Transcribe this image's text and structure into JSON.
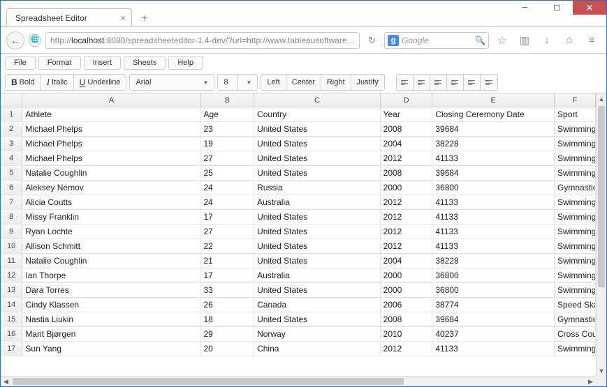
{
  "window": {
    "tab_title": "Spreadsheet Editor",
    "url_prefix": "http://",
    "url_host": "localhost",
    "url_rest": ":8080/spreadsheeteditor-1.4-dev/?url=http://www.tableausoftware…",
    "search_placeholder": "Google"
  },
  "menu": {
    "file": "File",
    "format": "Format",
    "insert": "Insert",
    "sheets": "Sheets",
    "help": "Help"
  },
  "toolbar": {
    "bold": "Bold",
    "italic": "Italic",
    "underline": "Underline",
    "font": "Arial",
    "size": "8",
    "left": "Left",
    "center": "Center",
    "right": "Right",
    "justify": "Justify"
  },
  "sheet": {
    "columns": [
      "A",
      "B",
      "C",
      "D",
      "E",
      "F"
    ],
    "col_widths_class": [
      "cA",
      "cB",
      "cC",
      "cD",
      "cE",
      "cF"
    ],
    "rows": [
      {
        "n": 1,
        "cells": [
          "Athlete",
          "Age",
          "Country",
          "Year",
          "Closing Ceremony Date",
          "Sport"
        ]
      },
      {
        "n": 2,
        "cells": [
          "Michael Phelps",
          "23",
          "United States",
          "2008",
          "39684",
          "Swimming"
        ]
      },
      {
        "n": 3,
        "cells": [
          "Michael Phelps",
          "19",
          "United States",
          "2004",
          "38228",
          "Swimming"
        ]
      },
      {
        "n": 4,
        "cells": [
          "Michael Phelps",
          "27",
          "United States",
          "2012",
          "41133",
          "Swimming"
        ]
      },
      {
        "n": 5,
        "cells": [
          "Natalie Coughlin",
          "25",
          "United States",
          "2008",
          "39684",
          "Swimming"
        ]
      },
      {
        "n": 6,
        "cells": [
          "Aleksey Nemov",
          "24",
          "Russia",
          "2000",
          "36800",
          "Gymnastics"
        ]
      },
      {
        "n": 7,
        "cells": [
          "Alicia Coutts",
          "24",
          "Australia",
          "2012",
          "41133",
          "Swimming"
        ]
      },
      {
        "n": 8,
        "cells": [
          "Missy Franklin",
          "17",
          "United States",
          "2012",
          "41133",
          "Swimming"
        ]
      },
      {
        "n": 9,
        "cells": [
          "Ryan Lochte",
          "27",
          "United States",
          "2012",
          "41133",
          "Swimming"
        ]
      },
      {
        "n": 10,
        "cells": [
          "Allison Schmitt",
          "22",
          "United States",
          "2012",
          "41133",
          "Swimming"
        ]
      },
      {
        "n": 11,
        "cells": [
          "Natalie Coughlin",
          "21",
          "United States",
          "2004",
          "38228",
          "Swimming"
        ]
      },
      {
        "n": 12,
        "cells": [
          "Ian Thorpe",
          "17",
          "Australia",
          "2000",
          "36800",
          "Swimming"
        ]
      },
      {
        "n": 13,
        "cells": [
          "Dara Torres",
          "33",
          "United States",
          "2000",
          "36800",
          "Swimming"
        ]
      },
      {
        "n": 14,
        "cells": [
          "Cindy Klassen",
          "26",
          "Canada",
          "2006",
          "38774",
          "Speed Skating"
        ]
      },
      {
        "n": 15,
        "cells": [
          "Nastia Liukin",
          "18",
          "United States",
          "2008",
          "39684",
          "Gymnastics"
        ]
      },
      {
        "n": 16,
        "cells": [
          "Marit Bjørgen",
          "29",
          "Norway",
          "2010",
          "40237",
          "Cross Country"
        ]
      },
      {
        "n": 17,
        "cells": [
          "Sun Yang",
          "20",
          "China",
          "2012",
          "41133",
          "Swimming"
        ]
      }
    ]
  }
}
